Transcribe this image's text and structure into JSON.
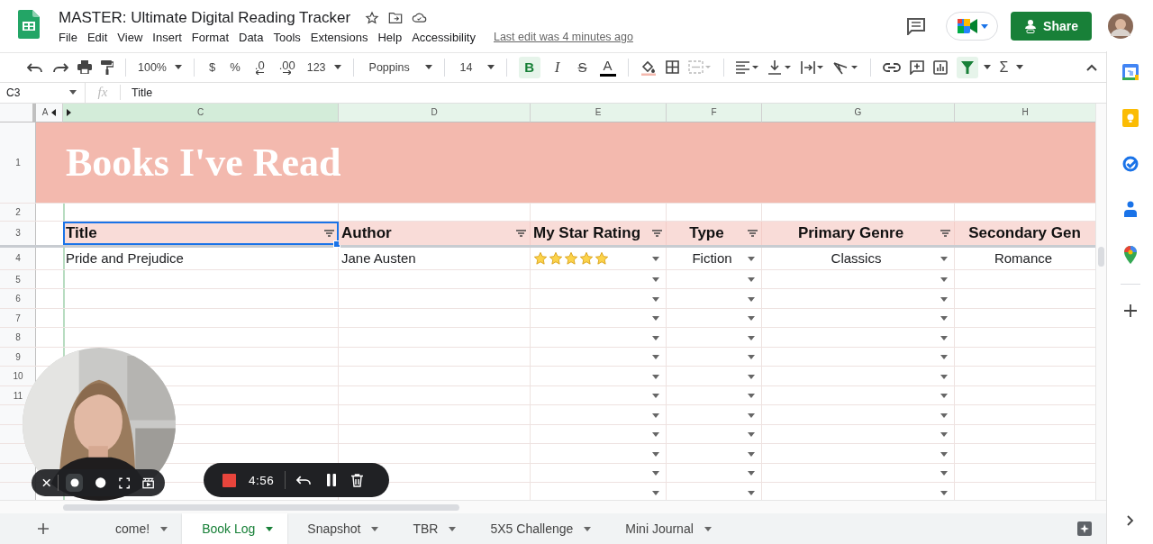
{
  "doc": {
    "title": "MASTER: Ultimate Digital Reading Tracker",
    "last_edit": "Last edit was 4 minutes ago"
  },
  "menu": [
    "File",
    "Edit",
    "View",
    "Insert",
    "Format",
    "Data",
    "Tools",
    "Extensions",
    "Help",
    "Accessibility"
  ],
  "share": {
    "label": "Share"
  },
  "toolbar": {
    "zoom": "100%",
    "currency": "$",
    "percent": "%",
    "decimal_less": ".0",
    "decimal_more": ".00",
    "number_format": "123",
    "font": "Poppins",
    "font_size": "14",
    "bold": "B",
    "italic": "I",
    "strike": "S",
    "text_color": "A",
    "sum": "Σ",
    "bold_on": true,
    "filter_on": true
  },
  "formula_bar": {
    "cell": "C3",
    "fx": "fx",
    "value": "Title"
  },
  "columns": [
    {
      "letter": "A",
      "selected": false,
      "in_range": false
    },
    {
      "letter": "C",
      "selected": true,
      "in_range": true
    },
    {
      "letter": "D",
      "selected": false,
      "in_range": true
    },
    {
      "letter": "E",
      "selected": false,
      "in_range": true
    },
    {
      "letter": "F",
      "selected": false,
      "in_range": true
    },
    {
      "letter": "G",
      "selected": false,
      "in_range": true
    },
    {
      "letter": "H",
      "selected": false,
      "in_range": true
    }
  ],
  "banner": {
    "row": "1",
    "title": "Books I've Read"
  },
  "spacer_row": {
    "number": "2"
  },
  "table": {
    "header_row": "3",
    "headers": [
      {
        "label": "Title",
        "selected": true
      },
      {
        "label": "Author",
        "selected": false
      },
      {
        "label": "My Star Rating",
        "selected": false
      },
      {
        "label": "Type",
        "selected": false
      },
      {
        "label": "Primary Genre",
        "selected": false
      },
      {
        "label": "Secondary Gen",
        "selected": false
      }
    ],
    "rows": [
      {
        "number": "4",
        "cells": [
          {
            "kind": "text",
            "text": "Pride and Prejudice"
          },
          {
            "kind": "text",
            "text": "Jane Austen"
          },
          {
            "kind": "stars",
            "stars": 5
          },
          {
            "kind": "text",
            "text": "Fiction"
          },
          {
            "kind": "text",
            "text": "Classics"
          },
          {
            "kind": "text",
            "text": "Romance"
          }
        ]
      }
    ],
    "empty_rows": [
      {
        "number": "5"
      },
      {
        "number": "6"
      },
      {
        "number": "7"
      },
      {
        "number": "8"
      },
      {
        "number": "9"
      },
      {
        "number": "10"
      },
      {
        "number": "11"
      }
    ]
  },
  "sheet_tabs": [
    {
      "label": "come!",
      "selected": false
    },
    {
      "label": "Book Log",
      "selected": true
    },
    {
      "label": "Snapshot",
      "selected": false
    },
    {
      "label": "TBR",
      "selected": false
    },
    {
      "label": "5X5 Challenge",
      "selected": false
    },
    {
      "label": "Mini Journal",
      "selected": false
    }
  ],
  "recorder": {
    "time": "4:56"
  }
}
